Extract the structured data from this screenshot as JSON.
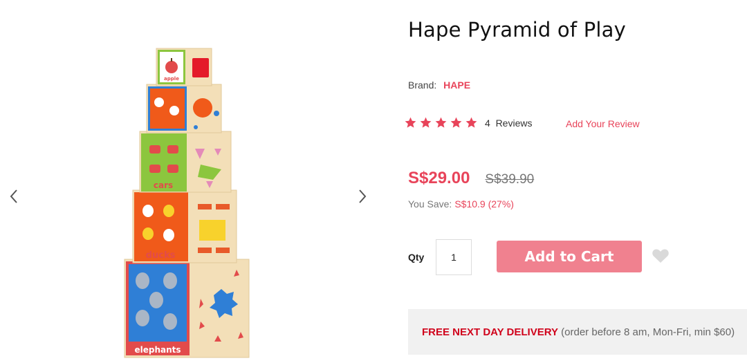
{
  "product": {
    "title": "Hape Pyramid of Play",
    "brand_label": "Brand:",
    "brand_name": "HAPE",
    "rating_stars": 5,
    "review_count_text": "4  Reviews",
    "add_review_label": "Add Your Review",
    "price": "S$29.00",
    "old_price": "S$39.90",
    "you_save_label": "You Save:",
    "you_save_value": "S$10.9 (27%)",
    "qty_label": "Qty",
    "qty_value": "1",
    "add_to_cart_label": "Add to Cart"
  },
  "delivery": {
    "highlight": "FREE NEXT DAY DELIVERY",
    "detail": " (order before 8 am, Mon-Fri, min $60)"
  },
  "image_labels": {
    "apple": "apple",
    "cars": "cars",
    "ducks": "ducks",
    "elephants": "elephants"
  },
  "colors": {
    "accent": "#e8445a",
    "button": "#f0818f",
    "delivery_highlight": "#d0021b",
    "delivery_bg": "#f1f1f1"
  },
  "icons": {
    "prev": "chevron-left-icon",
    "next": "chevron-right-icon",
    "star": "star-icon",
    "wishlist": "heart-icon"
  }
}
